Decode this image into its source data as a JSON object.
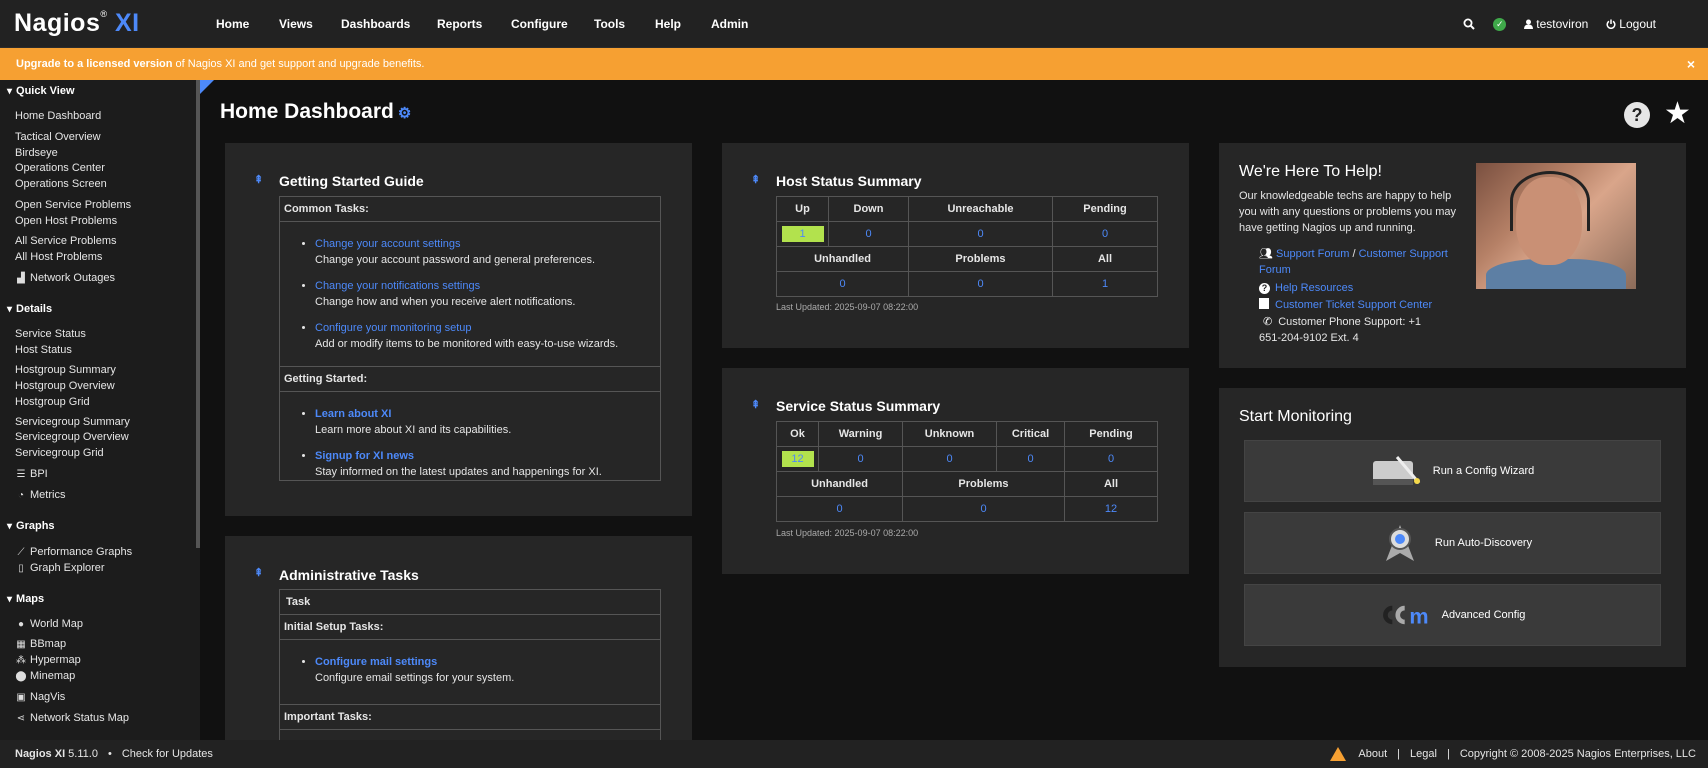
{
  "brand": {
    "name": "Nagios",
    "suffix": "XI"
  },
  "nav": {
    "items": [
      "Home",
      "Views",
      "Dashboards",
      "Reports",
      "Configure",
      "Tools",
      "Help",
      "Admin"
    ],
    "user": "testoviron",
    "logout": "Logout"
  },
  "banner": {
    "bold": "Upgrade to a licensed version",
    "rest": " of Nagios XI and get support and upgrade benefits.",
    "close": "×"
  },
  "sidebar": {
    "quick_view": {
      "title": "Quick View",
      "items": [
        "Home Dashboard",
        "Tactical Overview",
        "Birdseye",
        "Operations Center",
        "Operations Screen",
        "Open Service Problems",
        "Open Host Problems",
        "All Service Problems",
        "All Host Problems",
        "Network Outages"
      ]
    },
    "details": {
      "title": "Details",
      "items": [
        "Service Status",
        "Host Status",
        "Hostgroup Summary",
        "Hostgroup Overview",
        "Hostgroup Grid",
        "Servicegroup Summary",
        "Servicegroup Overview",
        "Servicegroup Grid",
        "BPI",
        "Metrics"
      ]
    },
    "graphs": {
      "title": "Graphs",
      "items": [
        "Performance Graphs",
        "Graph Explorer"
      ]
    },
    "maps": {
      "title": "Maps",
      "items": [
        "World Map",
        "BBmap",
        "Hypermap",
        "Minemap",
        "NagVis",
        "Network Status Map"
      ]
    }
  },
  "page": {
    "title": "Home Dashboard",
    "help_glyph": "?"
  },
  "getting_started": {
    "title": "Getting Started Guide",
    "common_tasks": "Common Tasks:",
    "tasks": [
      {
        "link": "Change your account settings",
        "desc": "Change your account password and general preferences."
      },
      {
        "link": "Change your notifications settings",
        "desc": "Change how and when you receive alert notifications."
      },
      {
        "link": "Configure your monitoring setup",
        "desc": "Add or modify items to be monitored with easy-to-use wizards."
      }
    ],
    "getting_started_label": "Getting Started:",
    "started": [
      {
        "link": "Learn about XI",
        "desc": "Learn more about XI and its capabilities."
      },
      {
        "link": "Signup for XI news",
        "desc": "Stay informed on the latest updates and happenings for XI."
      }
    ]
  },
  "admin_tasks": {
    "title": "Administrative Tasks",
    "task_header": "Task",
    "initial": "Initial Setup Tasks:",
    "mail_link": "Configure mail settings",
    "mail_desc": "Configure email settings for your system.",
    "important": "Important Tasks:"
  },
  "host_status": {
    "title": "Host Status Summary",
    "headers": [
      "Up",
      "Down",
      "Unreachable",
      "Pending"
    ],
    "values": [
      "1",
      "0",
      "0",
      "0"
    ],
    "headers2": [
      "Unhandled",
      "Problems",
      "All"
    ],
    "values2": [
      "0",
      "0",
      "1"
    ],
    "updated": "Last Updated: 2025-09-07 08:22:00"
  },
  "service_status": {
    "title": "Service Status Summary",
    "headers": [
      "Ok",
      "Warning",
      "Unknown",
      "Critical",
      "Pending"
    ],
    "values": [
      "12",
      "0",
      "0",
      "0",
      "0"
    ],
    "headers2": [
      "Unhandled",
      "Problems",
      "All"
    ],
    "values2": [
      "0",
      "0",
      "12"
    ],
    "updated": "Last Updated: 2025-09-07 08:22:00"
  },
  "help": {
    "title": "We're Here To Help!",
    "text": "Our knowledgeable techs are happy to help you with any questions or problems you may have getting Nagios up and running.",
    "support_forum": "Support Forum",
    "separator": " / ",
    "customer_support_forum": "Customer Support Forum",
    "help_resources": "Help Resources",
    "ticket_center": "Customer Ticket Support Center",
    "phone": "Customer Phone Support: +1 651-204-9102 Ext. 4"
  },
  "start_monitoring": {
    "title": "Start Monitoring",
    "buttons": [
      "Run a Config Wizard",
      "Run Auto-Discovery",
      "Advanced Config"
    ]
  },
  "footer": {
    "product": "Nagios XI",
    "version": " 5.11.0",
    "bullet": "•",
    "check_updates": "Check for Updates",
    "about": "About",
    "sep": "|",
    "legal": "Legal",
    "copyright": "Copyright © 2008-2025 Nagios Enterprises, LLC"
  },
  "colors": {
    "accent": "#4d89f9",
    "banner": "#f6a032",
    "ok": "#b2e24d"
  }
}
